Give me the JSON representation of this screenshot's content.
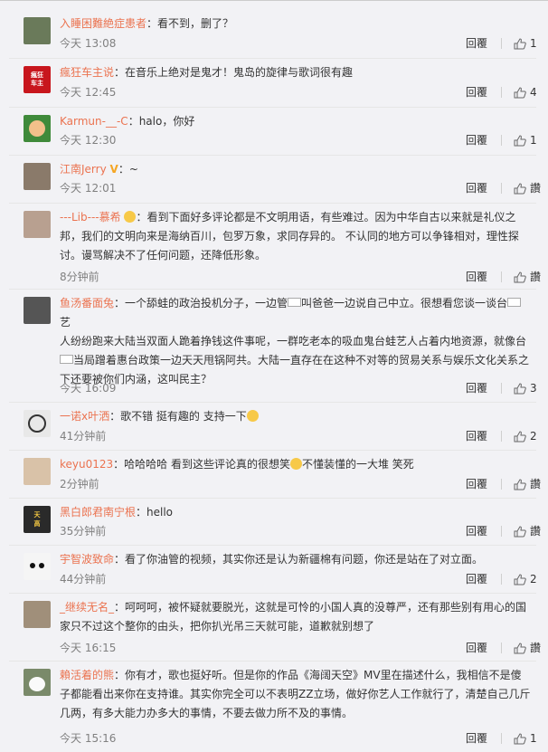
{
  "ui": {
    "reply_label": "回覆",
    "like_label_empty": "讚"
  },
  "comments": [
    {
      "user": "入睡困難絶症患者",
      "text": "：看不到，删了？",
      "time": "今天 13:08",
      "likes": "1",
      "avatar_color": "#6a7a5a",
      "avatar_icon": "person-photo-icon"
    },
    {
      "user": "瘋狂车主说",
      "text": "：在音乐上绝对是鬼才！鬼岛的旋律与歌词很有趣",
      "time": "今天 12:45",
      "likes": "4",
      "avatar_color": "#c8161d",
      "avatar_icon": "car-owner-logo-icon",
      "avatar_text": "瘋狂\n车主"
    },
    {
      "user": "Karmun-__-C",
      "text": "：halo，你好",
      "time": "今天 12:30",
      "likes": "1",
      "avatar_color": "#3f8a3a",
      "avatar_icon": "cartoon-avatar-icon"
    },
    {
      "user": "江南Jerry",
      "text": "：~",
      "time": "今天 12:01",
      "likes": "讚",
      "avatar_color": "#8a7a6a",
      "avatar_icon": "person-photo-icon"
    },
    {
      "user": "---Lib---慕希",
      "text_lines": [
        "：看到下面好多评论都是不文明用语，有些难过。因为中华自古以来就是礼仪之",
        "邦，我们的文明向来是海纳百川，包罗万象，求同存异的。 不认同的地方可以争锋相对，理性探",
        "讨。谩骂解决不了任何问题，还降低形象。"
      ],
      "time": "8分钟前",
      "likes": "讚",
      "avatar_color": "#b8a090",
      "avatar_icon": "person-photo-icon"
    },
    {
      "user": "鱼汤番面兔",
      "text_lines": [
        "：一个舔蛙的政治投机分子，一边管",
        "叫爸爸一边说自己中立。很想看您谈一谈台",
        "艺",
        "人纷纷跑来大陆当双面人跪着挣钱这件事呢，一群吃老本的吸血鬼台蛙艺人占着内地资源，就像台",
        "当局蹭着惠台政策一边天天甩锅阿共。大陆一直存在在这种不对等的贸易关系与娱乐文化关系之",
        "下还要被你们内涵，这叫民主？"
      ],
      "time": "今天 16:09",
      "likes": "3",
      "avatar_color": "#555555",
      "avatar_icon": "person-photo-icon"
    },
    {
      "user": "一诺x叶洒",
      "text": "：歌不错 挺有趣的 支持一下",
      "time": "41分钟前",
      "likes": "2",
      "avatar_color": "#e8e8e8",
      "avatar_icon": "cartoon-avatar-icon"
    },
    {
      "user": "keyu0123",
      "text": "：哈哈哈哈 看到这些评论真的很想笑",
      "text2": "不懂装懂的一大堆 笑死",
      "time": "2分钟前",
      "likes": "讚",
      "avatar_color": "#d9c2a8",
      "avatar_icon": "cartoon-avatar-icon"
    },
    {
      "user": "黑白郎君南宁根",
      "text": "：hello",
      "time": "35分钟前",
      "likes": "讚",
      "avatar_color": "#2a2a2a",
      "avatar_icon": "logo-avatar-icon",
      "avatar_text": "天\n高"
    },
    {
      "user": "宇智波致命",
      "text": "：看了你油管的视频，其实你还是认为新疆棉有问题，你还是站在了对立面。",
      "time": "44分钟前",
      "likes": "2",
      "avatar_color": "#f5f5f5",
      "avatar_icon": "panda-avatar-icon"
    },
    {
      "user": "_继续无名_",
      "text_lines": [
        "：呵呵呵，被怀疑就要脱光，这就是可怜的小国人真的没尊严，还有那些别有用心的国",
        "家只不过这个整你的由头，把你扒光吊三天就可能，道歉就别想了"
      ],
      "time": "今天 16:15",
      "likes": "讚",
      "avatar_color": "#a08f7a",
      "avatar_icon": "person-photo-icon"
    },
    {
      "user": "賴活着的熊",
      "text_lines": [
        "：你有才，歌也挺好听。但是你的作品《海阔天空》MV里在描述什么，我相信不是傻",
        "子都能看出来你在支持谁。其实你完全可以不表明ZZ立场，做好你艺人工作就行了，清楚自己几斤",
        "几两，有多大能力办多大的事情，不要去做力所不及的事情。"
      ],
      "time": "今天 15:16",
      "likes": "1",
      "avatar_color": "#7a8a6a",
      "avatar_icon": "panda-avatar-icon"
    }
  ]
}
